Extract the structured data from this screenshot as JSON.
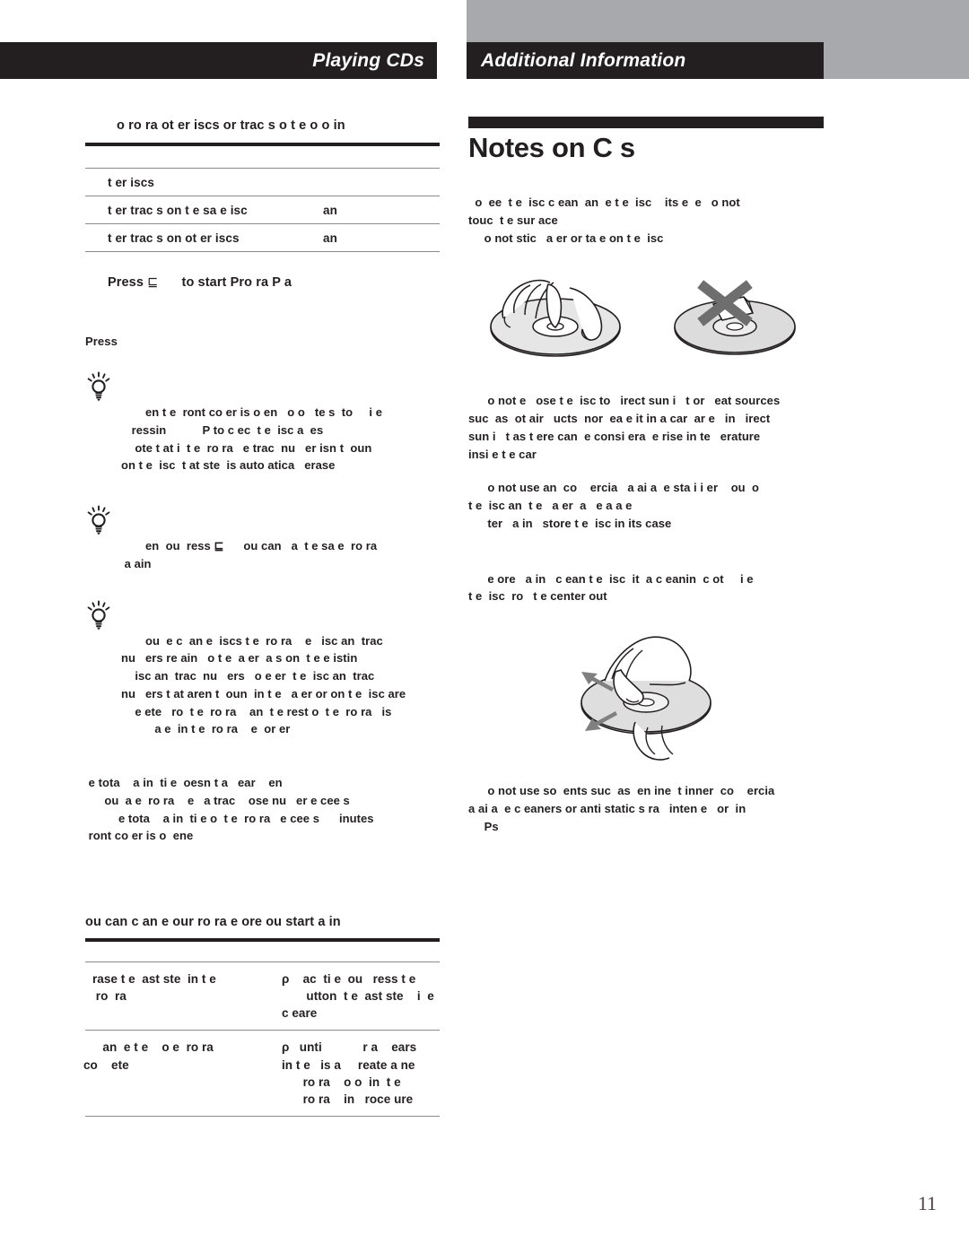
{
  "header": {
    "left_chapter": "Playing CDs",
    "right_chapter": "Additional Information"
  },
  "left_column": {
    "step_heading": "o  ro ra   ot er  iscs or trac s  o t e  o o  in",
    "mini_table": {
      "rows": [
        {
          "label": "t er   iscs",
          "value": ""
        },
        {
          "label": "t er trac s on t e sa  e  isc",
          "value": "an"
        },
        {
          "label": "t er trac s on ot er   iscs",
          "value": "an"
        }
      ]
    },
    "press_line_prefix": "Press",
    "press_line_glyph": "⊑",
    "press_line_suffix": "to start Pro  ra   P a",
    "press_label": "Press",
    "tips": [
      {
        "icon": "lightbulb-icon",
        "lines": [
          "   en t e  ront co er is o en   o o   te s  to     i e",
          " ressin           P to c ec  t e  isc a  es",
          "  ote t at i  t e  ro ra   e trac  nu   er isn t  oun ",
          "on t e  isc  t at ste  is auto atica   erase "
        ]
      },
      {
        "icon": "lightbulb-icon",
        "lines": [
          "   en  ou  ress ⊑      ou can   a  t e sa e  ro ra ",
          " a ain"
        ]
      },
      {
        "icon": "lightbulb-icon",
        "lines": [
          "   ou  e c  an e  iscs t e  ro ra    e   isc an  trac ",
          "nu   ers re ain   o t e  a er  a s on  t e e istin ",
          "  isc an  trac  nu   ers   o e er  t e  isc an  trac ",
          "nu   ers t at aren t  oun  in t e   a er or on t e  isc are",
          "  e ete   ro  t e  ro ra    an  t e rest o  t e  ro ra   is",
          "  a e  in t e  ro ra    e  or er"
        ]
      }
    ],
    "note_paragraph": {
      "lines": [
        " e tota    a in  ti e  oesn t a   ear    en",
        "  ou  a e  ro ra    e   a trac    ose nu   er e cee s ",
        "   e tota    a in  ti e o  t e  ro ra   e cee s      inutes",
        " ront co er is o  ene "
      ]
    },
    "bottom_heading": "ou can c  an e  our  ro ra    e ore  ou start   a in",
    "bottom_table": {
      "rows": [
        {
          "action_lines": [
            "rase t e  ast ste  in t e",
            " ro  ra "
          ],
          "do_lines": [
            "ρ    ac  ti e  ou   ress t e",
            "   utton  t e  ast ste    i  e",
            "c eare "
          ]
        },
        {
          "action_lines": [
            "   an  e t e    o e  ro ra ",
            "co    ete"
          ],
          "do_lines": [
            "ρ   unti            r a    ears",
            "in t e   is a     reate a ne",
            "  ro ra    o o  in  t e",
            "  ro ra    in   roce ure"
          ]
        }
      ]
    }
  },
  "right_column": {
    "section_title": "Notes on C  s",
    "block1": {
      "lines": [
        "  o  ee  t e  isc c ean  an  e t e  isc    its e  e   o not",
        "touc  t e sur ace",
        " o not stic   a er or ta e on t e  isc"
      ]
    },
    "figure1": {
      "name": "disc-handling-illustration",
      "left_caption": "hand-holding-disc-by-edge",
      "right_caption": "disc-with-label-crossed-out"
    },
    "block2": {
      "lines": [
        "  o not e   ose t e  isc to   irect sun i   t or   eat sources",
        "suc  as  ot air   ucts  nor  ea e it in a car  ar e   in   irect",
        "sun i   t as t ere can  e consi era  e rise in te   erature",
        "insi e t e car"
      ]
    },
    "block3": {
      "lines": [
        "  o not use an  co    ercia   a ai a  e sta i i er    ou  o ",
        "t e  isc an  t e   a er  a   e a a e",
        "  ter   a in   store t e  isc in its case"
      ]
    },
    "block4": {
      "lines": [
        "  e ore   a in   c ean t e  isc  it  a c eanin  c ot     i e",
        "t e  isc  ro   t e center out"
      ]
    },
    "figure2": {
      "name": "disc-cleaning-illustration",
      "caption": "wipe-disc-from-center-outward"
    },
    "block5": {
      "lines": [
        "  o not use so  ents suc  as  en ine  t inner  co    ercia",
        "a ai a  e c eaners or anti static s ra   inten e   or  in",
        " Ps"
      ]
    }
  },
  "footer": {
    "page_number": "11"
  },
  "colors": {
    "ink": "#231f20",
    "gray_block": "#a7a9ac",
    "rule": "#8a8a8a",
    "disc_fill": "#d6d6d6",
    "page_number": "#4a3f42"
  }
}
